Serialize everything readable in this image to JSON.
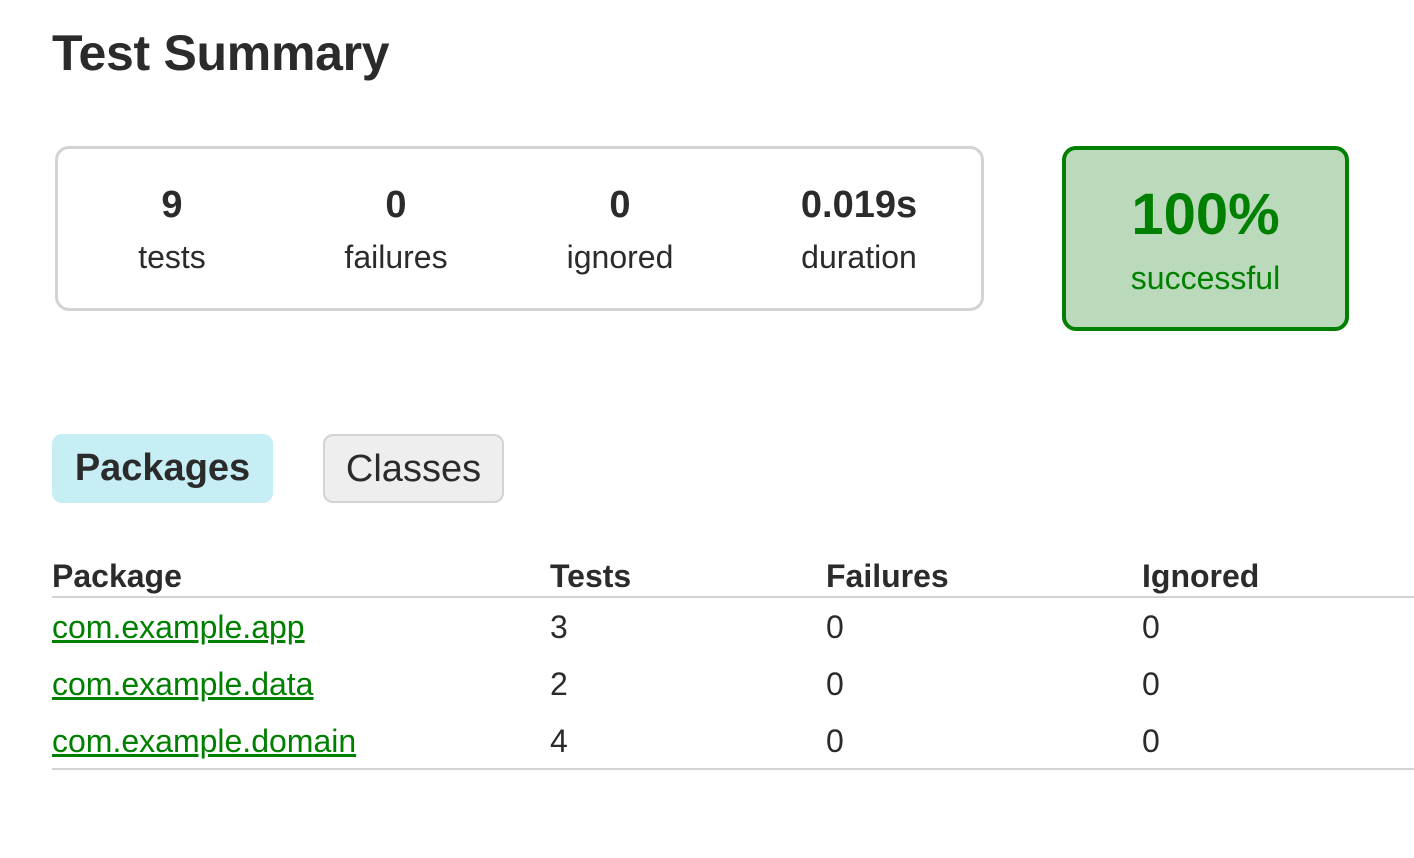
{
  "page": {
    "title": "Test Summary"
  },
  "summary": {
    "tests": {
      "value": "9",
      "label": "tests"
    },
    "failures": {
      "value": "0",
      "label": "failures"
    },
    "ignored": {
      "value": "0",
      "label": "ignored"
    },
    "duration": {
      "value": "0.019s",
      "label": "duration"
    }
  },
  "success": {
    "rate": "100%",
    "label": "successful"
  },
  "tabs": [
    {
      "label": "Packages",
      "active": true
    },
    {
      "label": "Classes",
      "active": false
    }
  ],
  "table": {
    "headers": [
      "Package",
      "Tests",
      "Failures",
      "Ignored"
    ],
    "rows": [
      {
        "package": "com.example.app",
        "tests": "3",
        "failures": "0",
        "ignored": "0"
      },
      {
        "package": "com.example.data",
        "tests": "2",
        "failures": "0",
        "ignored": "0"
      },
      {
        "package": "com.example.domain",
        "tests": "4",
        "failures": "0",
        "ignored": "0"
      }
    ]
  },
  "colors": {
    "success_green": "#008000",
    "success_bg": "#bbd9bb",
    "active_tab_bg": "#c6eef4",
    "inactive_tab_bg": "#eeeeee",
    "border_gray": "#d3d3d3",
    "text": "#2b2b2b"
  }
}
